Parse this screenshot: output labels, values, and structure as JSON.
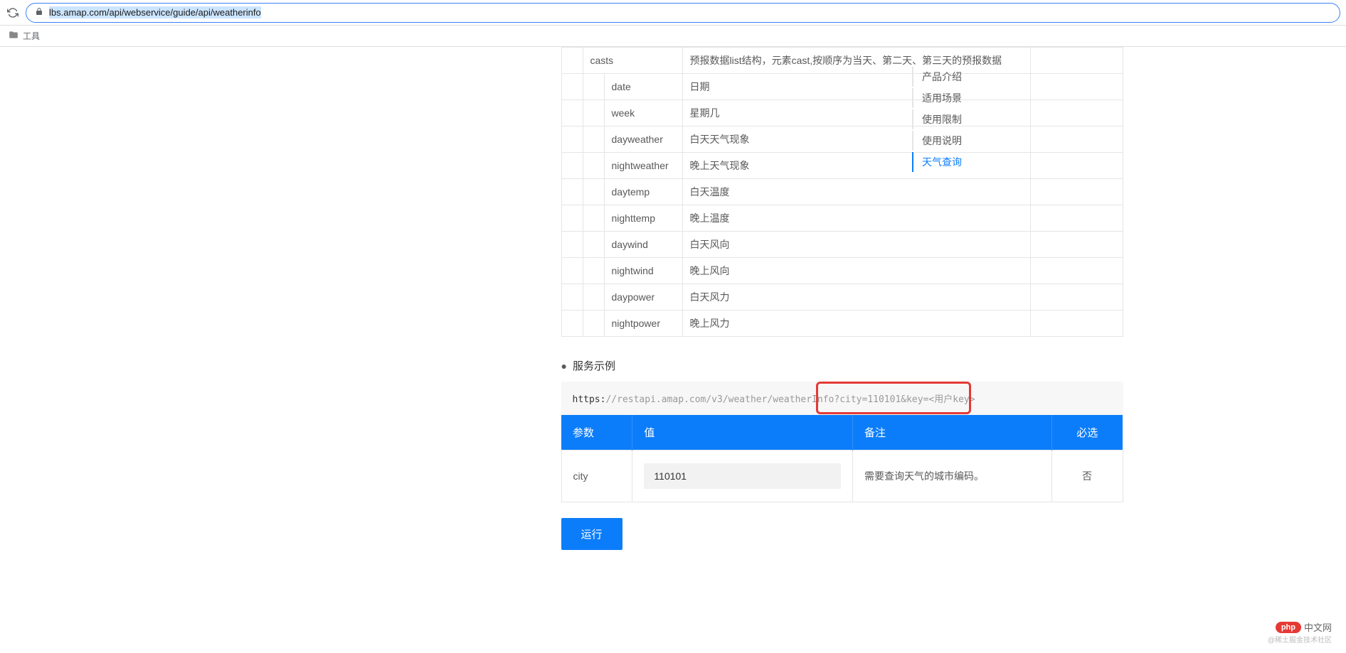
{
  "browser": {
    "url_display": "lbs.amap.com/api/webservice/guide/api/weatherinfo"
  },
  "bookmark": {
    "folder": "工具"
  },
  "api_rows": [
    {
      "key": "casts",
      "desc": "预报数据list结构，元素cast,按顺序为当天、第二天、第三天的预报数据",
      "indent": 1
    },
    {
      "key": "date",
      "desc": "日期",
      "indent": 2
    },
    {
      "key": "week",
      "desc": "星期几",
      "indent": 2
    },
    {
      "key": "dayweather",
      "desc": "白天天气现象",
      "indent": 2
    },
    {
      "key": "nightweather",
      "desc": "晚上天气现象",
      "indent": 2
    },
    {
      "key": "daytemp",
      "desc": "白天温度",
      "indent": 2
    },
    {
      "key": "nighttemp",
      "desc": "晚上温度",
      "indent": 2
    },
    {
      "key": "daywind",
      "desc": "白天风向",
      "indent": 2
    },
    {
      "key": "nightwind",
      "desc": "晚上风向",
      "indent": 2
    },
    {
      "key": "daypower",
      "desc": "白天风力",
      "indent": 2
    },
    {
      "key": "nightpower",
      "desc": "晚上风力",
      "indent": 2
    }
  ],
  "service_example": {
    "title": "服务示例",
    "url_https": "https:",
    "url_rest": "//restapi.amap.com/v3/weather/weatherInfo?city=110101&key=<用户key>"
  },
  "params_table": {
    "headers": {
      "param": "参数",
      "value": "值",
      "note": "备注",
      "required": "必选"
    },
    "row": {
      "param": "city",
      "value": "110101",
      "note": "需要查询天气的城市编码。",
      "required": "否"
    }
  },
  "run_label": "运行",
  "right_nav": {
    "items": [
      "产品介绍",
      "适用场景",
      "使用限制",
      "使用说明",
      "天气查询"
    ],
    "active_index": 4
  },
  "watermark": {
    "php_brand": "php",
    "php_text": "中文网",
    "juejin": "@稀土掘金技术社区"
  }
}
